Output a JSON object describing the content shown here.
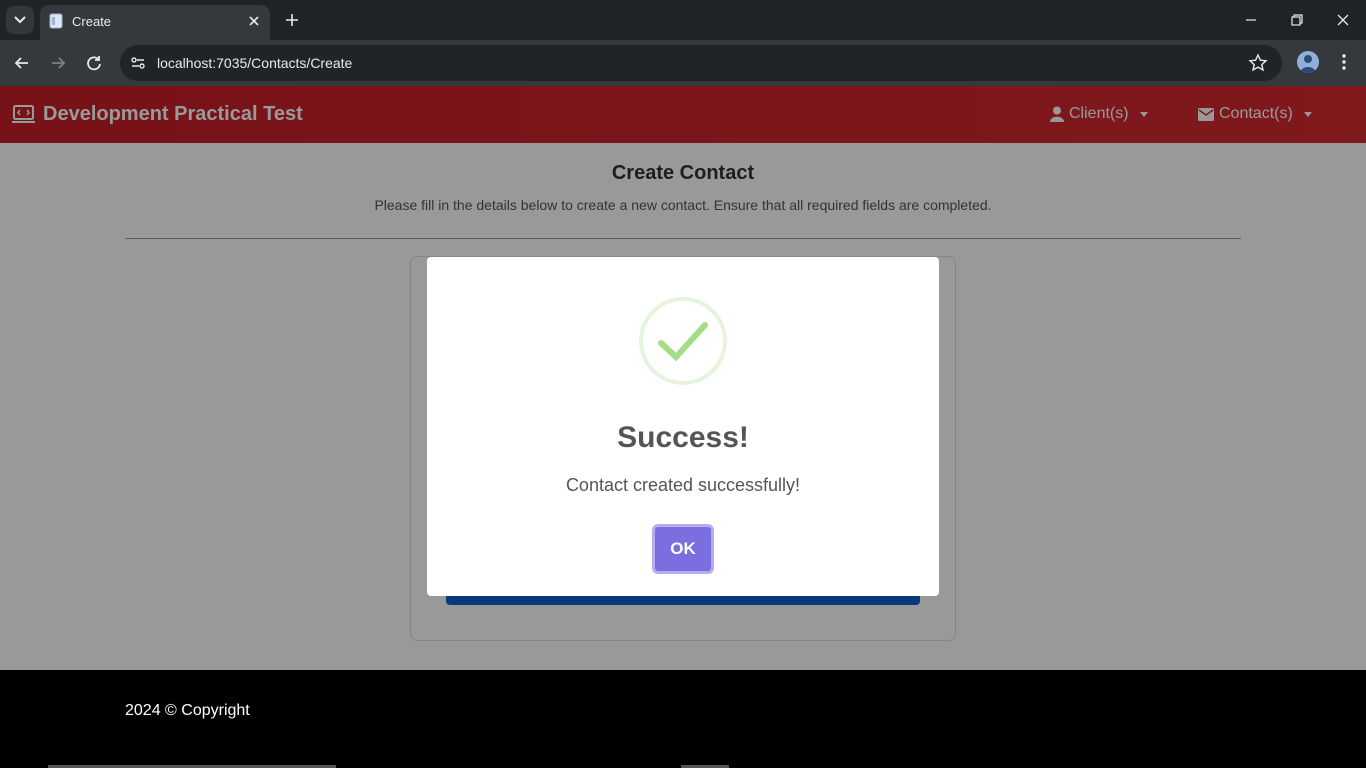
{
  "browser": {
    "tab_title": "Create",
    "url_host": "localhost:7035",
    "url_path": "/Contacts/Create"
  },
  "navbar": {
    "brand": "Development Practical Test",
    "clients_label": "Client(s)",
    "contacts_label": "Contact(s)"
  },
  "content": {
    "title": "Create Contact",
    "subtitle": "Please fill in the details below to create a new contact. Ensure that all required fields are completed."
  },
  "footer": {
    "text": "2024 © Copyright"
  },
  "modal": {
    "title": "Success!",
    "message": "Contact created successfully!",
    "ok_label": "OK"
  },
  "colors": {
    "navbar": "#d0252d",
    "success_check": "#a5dc86",
    "ok_button": "#7a6ee0",
    "submit_button": "#0d5fcf"
  }
}
